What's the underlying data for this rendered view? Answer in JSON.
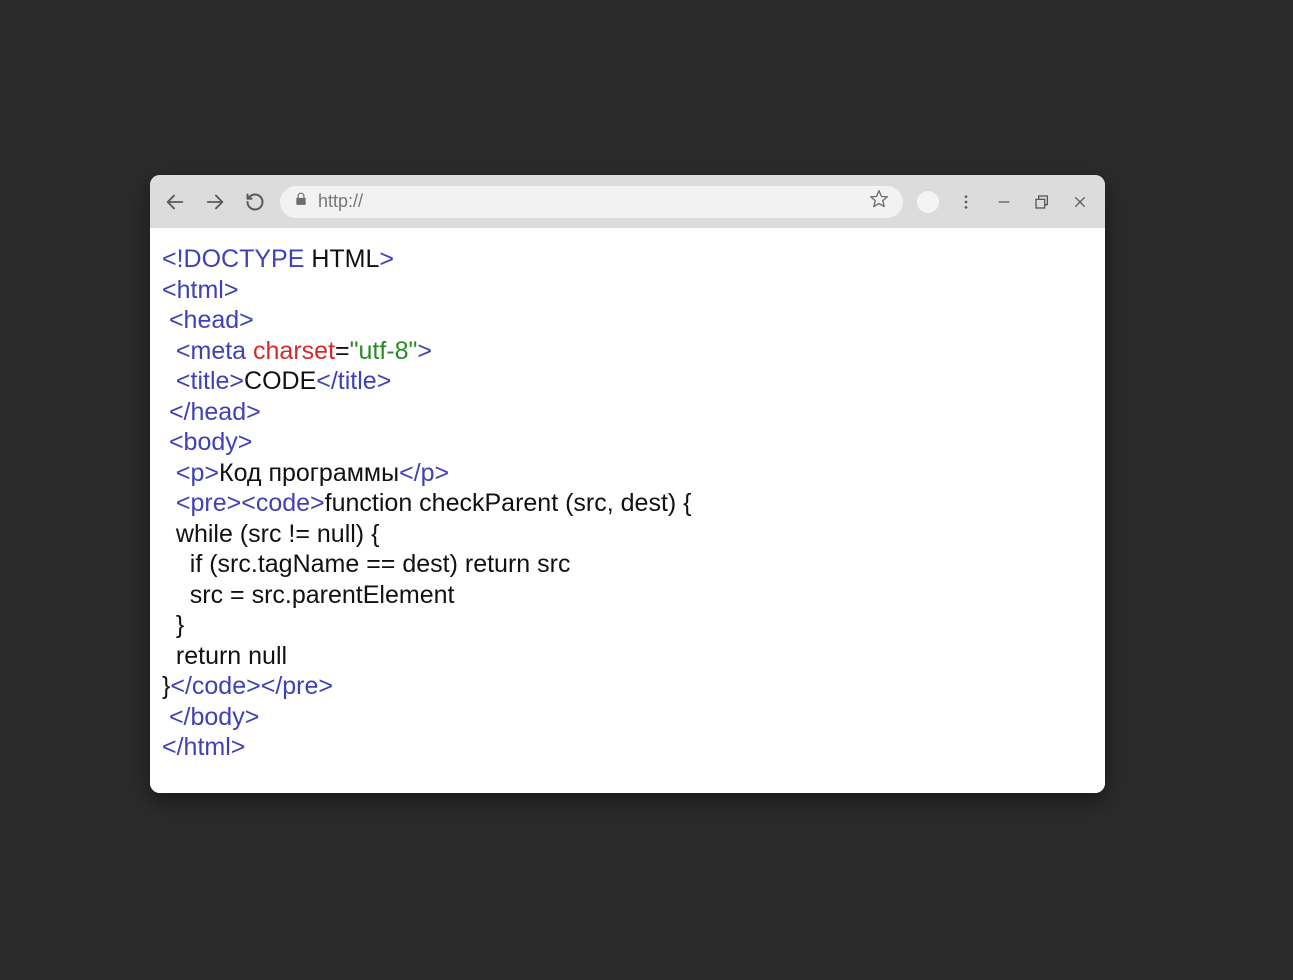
{
  "toolbar": {
    "url": "http://"
  },
  "code": {
    "l1_doctype_open": "<!DOCTYPE",
    "l1_doctype_space": " ",
    "l1_html_word": "HTML",
    "l1_close": ">",
    "l2": "<html>",
    "l3_indent": " ",
    "l3": "<head>",
    "l4_indent": "  ",
    "l4_meta_open": "<meta ",
    "l4_attr": "charset",
    "l4_eq": "=",
    "l4_val": "\"utf-8\"",
    "l4_close": ">",
    "l5_indent": "  ",
    "l5_open": "<title>",
    "l5_text": "CODE",
    "l5_close": "</title>",
    "l6_indent": " ",
    "l6": "</head>",
    "l7_indent": " ",
    "l7": "<body>",
    "l8_indent": "  ",
    "l8_open": "<p>",
    "l8_text": "Код программы",
    "l8_close": "</p>",
    "l9_indent": "  ",
    "l9_pre": "<pre>",
    "l9_code": "<code>",
    "l9_text": "function checkParent (src, dest) {",
    "l10": "  while (src != null) {",
    "l11": "    if (src.tagName == dest) return src",
    "l12": "    src = src.parentElement",
    "l13": "  }",
    "l14": "  return null",
    "l15_brace": "}",
    "l15_code_close": "</code>",
    "l15_pre_close": "</pre>",
    "l16_indent": " ",
    "l16": "</body>",
    "l17": "</html>"
  }
}
